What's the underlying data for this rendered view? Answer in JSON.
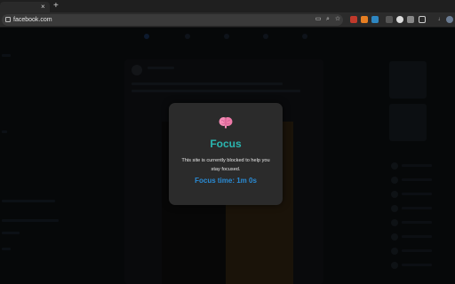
{
  "browser": {
    "url": "facebook.com",
    "tab_close": "×",
    "new_tab": "+"
  },
  "toolbar_icons": [
    "cast-icon",
    "zoom-icon",
    "bookmark-star-icon"
  ],
  "modal": {
    "icon": "brain-icon",
    "title": "Focus",
    "message": "This site is currently blocked to help you stay focused.",
    "timer": "Focus time: 1m 0s",
    "colors": {
      "title": "#2bb6b0",
      "timer": "#2a8cd6",
      "background": "#2b2b2b"
    }
  }
}
